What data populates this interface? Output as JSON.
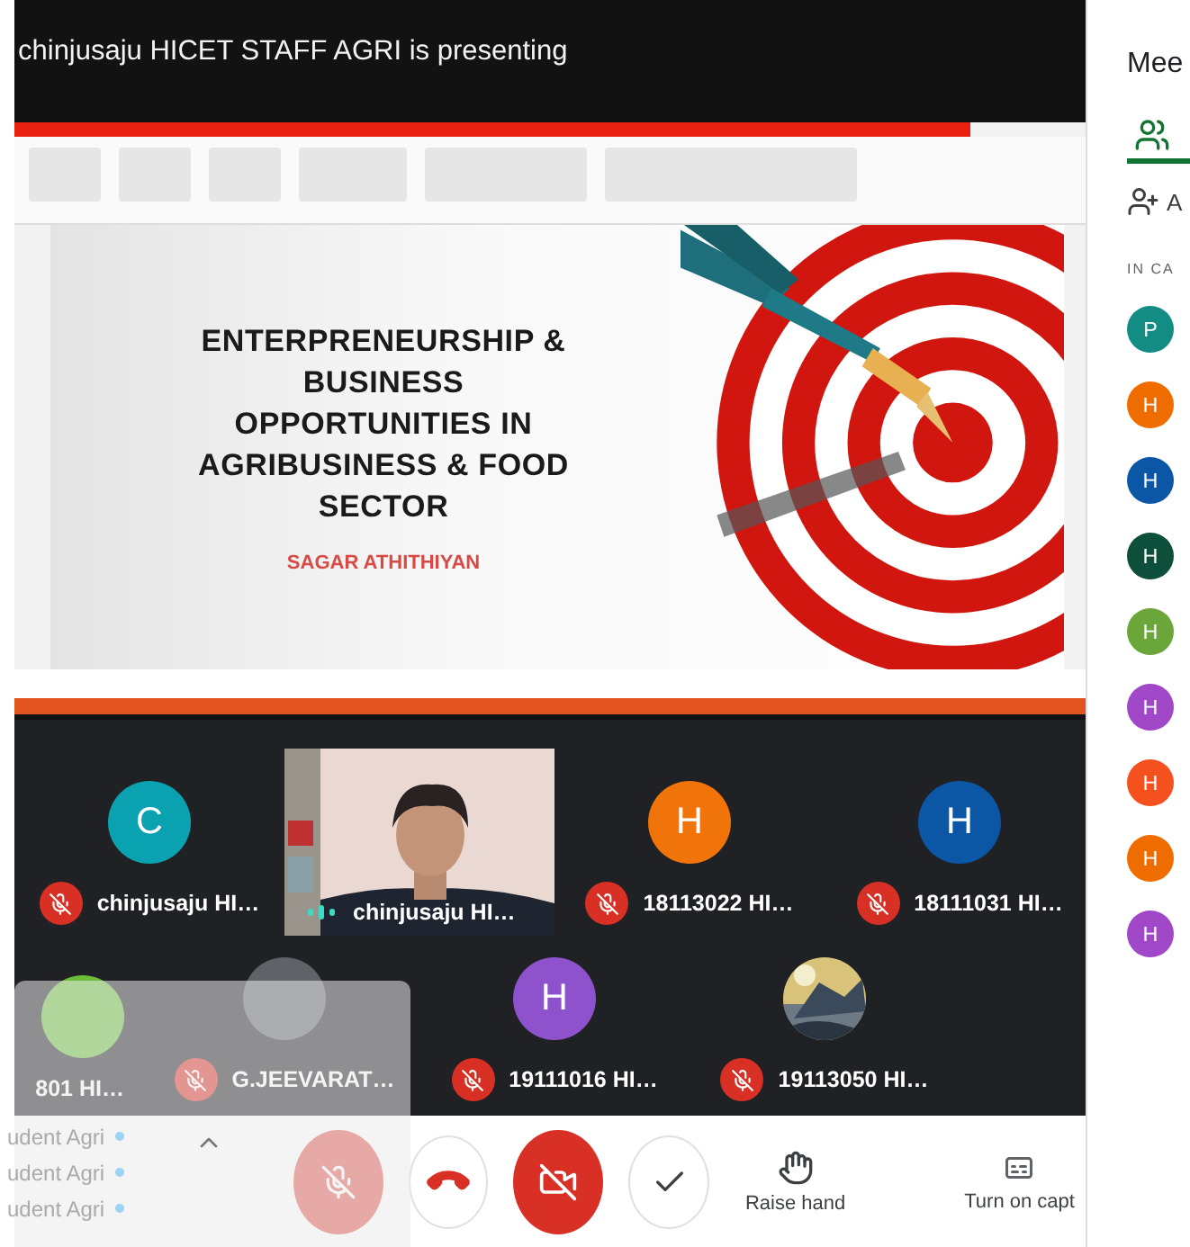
{
  "presenter_banner": "chinjusaju HICET STAFF AGRI is presenting",
  "slide": {
    "title_lines": [
      "ENTERPRENEURSHIP &",
      "BUSINESS",
      "OPPORTUNITIES IN",
      "AGRIBUSINESS & FOOD",
      "SECTOR"
    ],
    "author": "SAGAR ATHITHIYAN"
  },
  "tiles_row_1": [
    {
      "kind": "avatar",
      "initial": "C",
      "color": "#0aa1b0",
      "name": "chinjusaju HI…",
      "muted": true
    },
    {
      "kind": "video",
      "name": "chinjusaju HI…",
      "muted": false
    },
    {
      "kind": "avatar",
      "initial": "H",
      "color": "#f07409",
      "name": "18113022 HI…",
      "muted": true
    },
    {
      "kind": "avatar",
      "initial": "H",
      "color": "#0b57a6",
      "name": "18111031 HI…",
      "muted": true
    }
  ],
  "tiles_row_2": [
    {
      "kind": "avatar",
      "color": "#6bbd3a",
      "name": "801 HI…"
    },
    {
      "kind": "avatar",
      "color": "#5f6368",
      "name": "G.JEEVARAT…",
      "muted": true
    },
    {
      "kind": "avatar",
      "initial": "H",
      "color": "#8e52cc",
      "name": "19111016 HI…",
      "muted": true
    },
    {
      "name": "19113050 HI…",
      "muted": true
    }
  ],
  "overlay_rows": [
    "udent Agri",
    "udent Agri",
    "udent Agri"
  ],
  "controls": [
    {
      "kind": "mic",
      "on": false
    },
    {
      "kind": "hangup"
    },
    {
      "kind": "camera",
      "on": false
    },
    {
      "kind": "check"
    },
    {
      "kind": "raise_hand",
      "label": "Raise hand"
    },
    {
      "kind": "captions",
      "label": "Turn on capt"
    }
  ],
  "side_panel": {
    "title": "Mee",
    "tab": {
      "selected": true
    },
    "add_label": "A",
    "section": "IN CA",
    "participants": [
      {
        "initial": "P",
        "color": "#138d83"
      },
      {
        "initial": "H",
        "color": "#ef6c00"
      },
      {
        "initial": "H",
        "color": "#0b57a6"
      },
      {
        "initial": "H",
        "color": "#0d4f3a"
      },
      {
        "initial": "H",
        "color": "#6aa63a"
      },
      {
        "initial": "H",
        "color": "#a048c8"
      },
      {
        "initial": "H",
        "color": "#f4511e"
      },
      {
        "initial": "H",
        "color": "#ef6c00"
      },
      {
        "initial": "H",
        "color": "#a048c8"
      }
    ]
  }
}
